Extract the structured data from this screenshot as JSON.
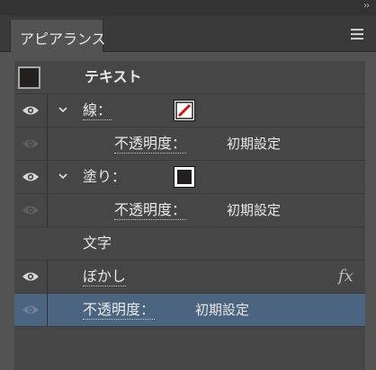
{
  "panel": {
    "tab_label": "アピアランス",
    "collapse_glyph": "››",
    "menu_icon": "hamburger-menu-icon"
  },
  "rows": {
    "object": {
      "label": "テキスト",
      "thumbnail_color": "#231f1e"
    },
    "stroke": {
      "label": "線：",
      "visible": true,
      "expanded": true,
      "swatch": "none (red slash)"
    },
    "stroke_opacity": {
      "label": "不透明度：",
      "value": "初期設定",
      "visible": false
    },
    "fill": {
      "label": "塗り：",
      "visible": true,
      "expanded": true,
      "swatch_color": "#231f1e"
    },
    "fill_opacity": {
      "label": "不透明度：",
      "value": "初期設定",
      "visible": false
    },
    "characters": {
      "label": "文字"
    },
    "blur": {
      "label": "ぼかし",
      "visible": true,
      "fx_label": "fx"
    },
    "opacity": {
      "label": "不透明度：",
      "value": "初期設定",
      "visible": false,
      "selected": true
    }
  },
  "colors": {
    "selected_row": "#4b6480",
    "none_slash": "#d0121b"
  }
}
